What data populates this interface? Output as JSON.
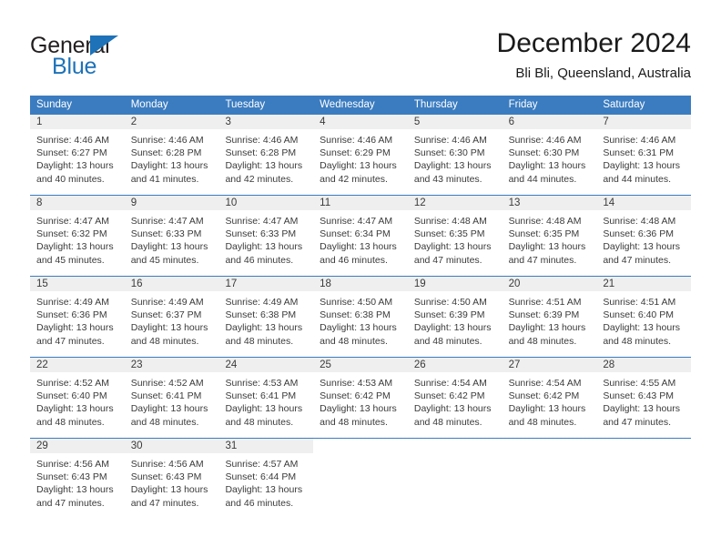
{
  "brand": {
    "name_part1": "General",
    "name_part2": "Blue",
    "triangle_color": "#1d72b8"
  },
  "header": {
    "title": "December 2024",
    "subtitle": "Bli Bli, Queensland, Australia"
  },
  "colors": {
    "header_row_bg": "#3b7cc0",
    "header_row_text": "#ffffff",
    "daynum_band_bg": "#efefef",
    "text": "#3a3a3a",
    "accent": "#1d72b8"
  },
  "weekdays": [
    "Sunday",
    "Monday",
    "Tuesday",
    "Wednesday",
    "Thursday",
    "Friday",
    "Saturday"
  ],
  "weeks": [
    [
      {
        "day": "1",
        "sunrise": "Sunrise: 4:46 AM",
        "sunset": "Sunset: 6:27 PM",
        "daylight1": "Daylight: 13 hours",
        "daylight2": "and 40 minutes."
      },
      {
        "day": "2",
        "sunrise": "Sunrise: 4:46 AM",
        "sunset": "Sunset: 6:28 PM",
        "daylight1": "Daylight: 13 hours",
        "daylight2": "and 41 minutes."
      },
      {
        "day": "3",
        "sunrise": "Sunrise: 4:46 AM",
        "sunset": "Sunset: 6:28 PM",
        "daylight1": "Daylight: 13 hours",
        "daylight2": "and 42 minutes."
      },
      {
        "day": "4",
        "sunrise": "Sunrise: 4:46 AM",
        "sunset": "Sunset: 6:29 PM",
        "daylight1": "Daylight: 13 hours",
        "daylight2": "and 42 minutes."
      },
      {
        "day": "5",
        "sunrise": "Sunrise: 4:46 AM",
        "sunset": "Sunset: 6:30 PM",
        "daylight1": "Daylight: 13 hours",
        "daylight2": "and 43 minutes."
      },
      {
        "day": "6",
        "sunrise": "Sunrise: 4:46 AM",
        "sunset": "Sunset: 6:30 PM",
        "daylight1": "Daylight: 13 hours",
        "daylight2": "and 44 minutes."
      },
      {
        "day": "7",
        "sunrise": "Sunrise: 4:46 AM",
        "sunset": "Sunset: 6:31 PM",
        "daylight1": "Daylight: 13 hours",
        "daylight2": "and 44 minutes."
      }
    ],
    [
      {
        "day": "8",
        "sunrise": "Sunrise: 4:47 AM",
        "sunset": "Sunset: 6:32 PM",
        "daylight1": "Daylight: 13 hours",
        "daylight2": "and 45 minutes."
      },
      {
        "day": "9",
        "sunrise": "Sunrise: 4:47 AM",
        "sunset": "Sunset: 6:33 PM",
        "daylight1": "Daylight: 13 hours",
        "daylight2": "and 45 minutes."
      },
      {
        "day": "10",
        "sunrise": "Sunrise: 4:47 AM",
        "sunset": "Sunset: 6:33 PM",
        "daylight1": "Daylight: 13 hours",
        "daylight2": "and 46 minutes."
      },
      {
        "day": "11",
        "sunrise": "Sunrise: 4:47 AM",
        "sunset": "Sunset: 6:34 PM",
        "daylight1": "Daylight: 13 hours",
        "daylight2": "and 46 minutes."
      },
      {
        "day": "12",
        "sunrise": "Sunrise: 4:48 AM",
        "sunset": "Sunset: 6:35 PM",
        "daylight1": "Daylight: 13 hours",
        "daylight2": "and 47 minutes."
      },
      {
        "day": "13",
        "sunrise": "Sunrise: 4:48 AM",
        "sunset": "Sunset: 6:35 PM",
        "daylight1": "Daylight: 13 hours",
        "daylight2": "and 47 minutes."
      },
      {
        "day": "14",
        "sunrise": "Sunrise: 4:48 AM",
        "sunset": "Sunset: 6:36 PM",
        "daylight1": "Daylight: 13 hours",
        "daylight2": "and 47 minutes."
      }
    ],
    [
      {
        "day": "15",
        "sunrise": "Sunrise: 4:49 AM",
        "sunset": "Sunset: 6:36 PM",
        "daylight1": "Daylight: 13 hours",
        "daylight2": "and 47 minutes."
      },
      {
        "day": "16",
        "sunrise": "Sunrise: 4:49 AM",
        "sunset": "Sunset: 6:37 PM",
        "daylight1": "Daylight: 13 hours",
        "daylight2": "and 48 minutes."
      },
      {
        "day": "17",
        "sunrise": "Sunrise: 4:49 AM",
        "sunset": "Sunset: 6:38 PM",
        "daylight1": "Daylight: 13 hours",
        "daylight2": "and 48 minutes."
      },
      {
        "day": "18",
        "sunrise": "Sunrise: 4:50 AM",
        "sunset": "Sunset: 6:38 PM",
        "daylight1": "Daylight: 13 hours",
        "daylight2": "and 48 minutes."
      },
      {
        "day": "19",
        "sunrise": "Sunrise: 4:50 AM",
        "sunset": "Sunset: 6:39 PM",
        "daylight1": "Daylight: 13 hours",
        "daylight2": "and 48 minutes."
      },
      {
        "day": "20",
        "sunrise": "Sunrise: 4:51 AM",
        "sunset": "Sunset: 6:39 PM",
        "daylight1": "Daylight: 13 hours",
        "daylight2": "and 48 minutes."
      },
      {
        "day": "21",
        "sunrise": "Sunrise: 4:51 AM",
        "sunset": "Sunset: 6:40 PM",
        "daylight1": "Daylight: 13 hours",
        "daylight2": "and 48 minutes."
      }
    ],
    [
      {
        "day": "22",
        "sunrise": "Sunrise: 4:52 AM",
        "sunset": "Sunset: 6:40 PM",
        "daylight1": "Daylight: 13 hours",
        "daylight2": "and 48 minutes."
      },
      {
        "day": "23",
        "sunrise": "Sunrise: 4:52 AM",
        "sunset": "Sunset: 6:41 PM",
        "daylight1": "Daylight: 13 hours",
        "daylight2": "and 48 minutes."
      },
      {
        "day": "24",
        "sunrise": "Sunrise: 4:53 AM",
        "sunset": "Sunset: 6:41 PM",
        "daylight1": "Daylight: 13 hours",
        "daylight2": "and 48 minutes."
      },
      {
        "day": "25",
        "sunrise": "Sunrise: 4:53 AM",
        "sunset": "Sunset: 6:42 PM",
        "daylight1": "Daylight: 13 hours",
        "daylight2": "and 48 minutes."
      },
      {
        "day": "26",
        "sunrise": "Sunrise: 4:54 AM",
        "sunset": "Sunset: 6:42 PM",
        "daylight1": "Daylight: 13 hours",
        "daylight2": "and 48 minutes."
      },
      {
        "day": "27",
        "sunrise": "Sunrise: 4:54 AM",
        "sunset": "Sunset: 6:42 PM",
        "daylight1": "Daylight: 13 hours",
        "daylight2": "and 48 minutes."
      },
      {
        "day": "28",
        "sunrise": "Sunrise: 4:55 AM",
        "sunset": "Sunset: 6:43 PM",
        "daylight1": "Daylight: 13 hours",
        "daylight2": "and 47 minutes."
      }
    ],
    [
      {
        "day": "29",
        "sunrise": "Sunrise: 4:56 AM",
        "sunset": "Sunset: 6:43 PM",
        "daylight1": "Daylight: 13 hours",
        "daylight2": "and 47 minutes."
      },
      {
        "day": "30",
        "sunrise": "Sunrise: 4:56 AM",
        "sunset": "Sunset: 6:43 PM",
        "daylight1": "Daylight: 13 hours",
        "daylight2": "and 47 minutes."
      },
      {
        "day": "31",
        "sunrise": "Sunrise: 4:57 AM",
        "sunset": "Sunset: 6:44 PM",
        "daylight1": "Daylight: 13 hours",
        "daylight2": "and 46 minutes."
      },
      {
        "day": "",
        "sunrise": "",
        "sunset": "",
        "daylight1": "",
        "daylight2": ""
      },
      {
        "day": "",
        "sunrise": "",
        "sunset": "",
        "daylight1": "",
        "daylight2": ""
      },
      {
        "day": "",
        "sunrise": "",
        "sunset": "",
        "daylight1": "",
        "daylight2": ""
      },
      {
        "day": "",
        "sunrise": "",
        "sunset": "",
        "daylight1": "",
        "daylight2": ""
      }
    ]
  ]
}
